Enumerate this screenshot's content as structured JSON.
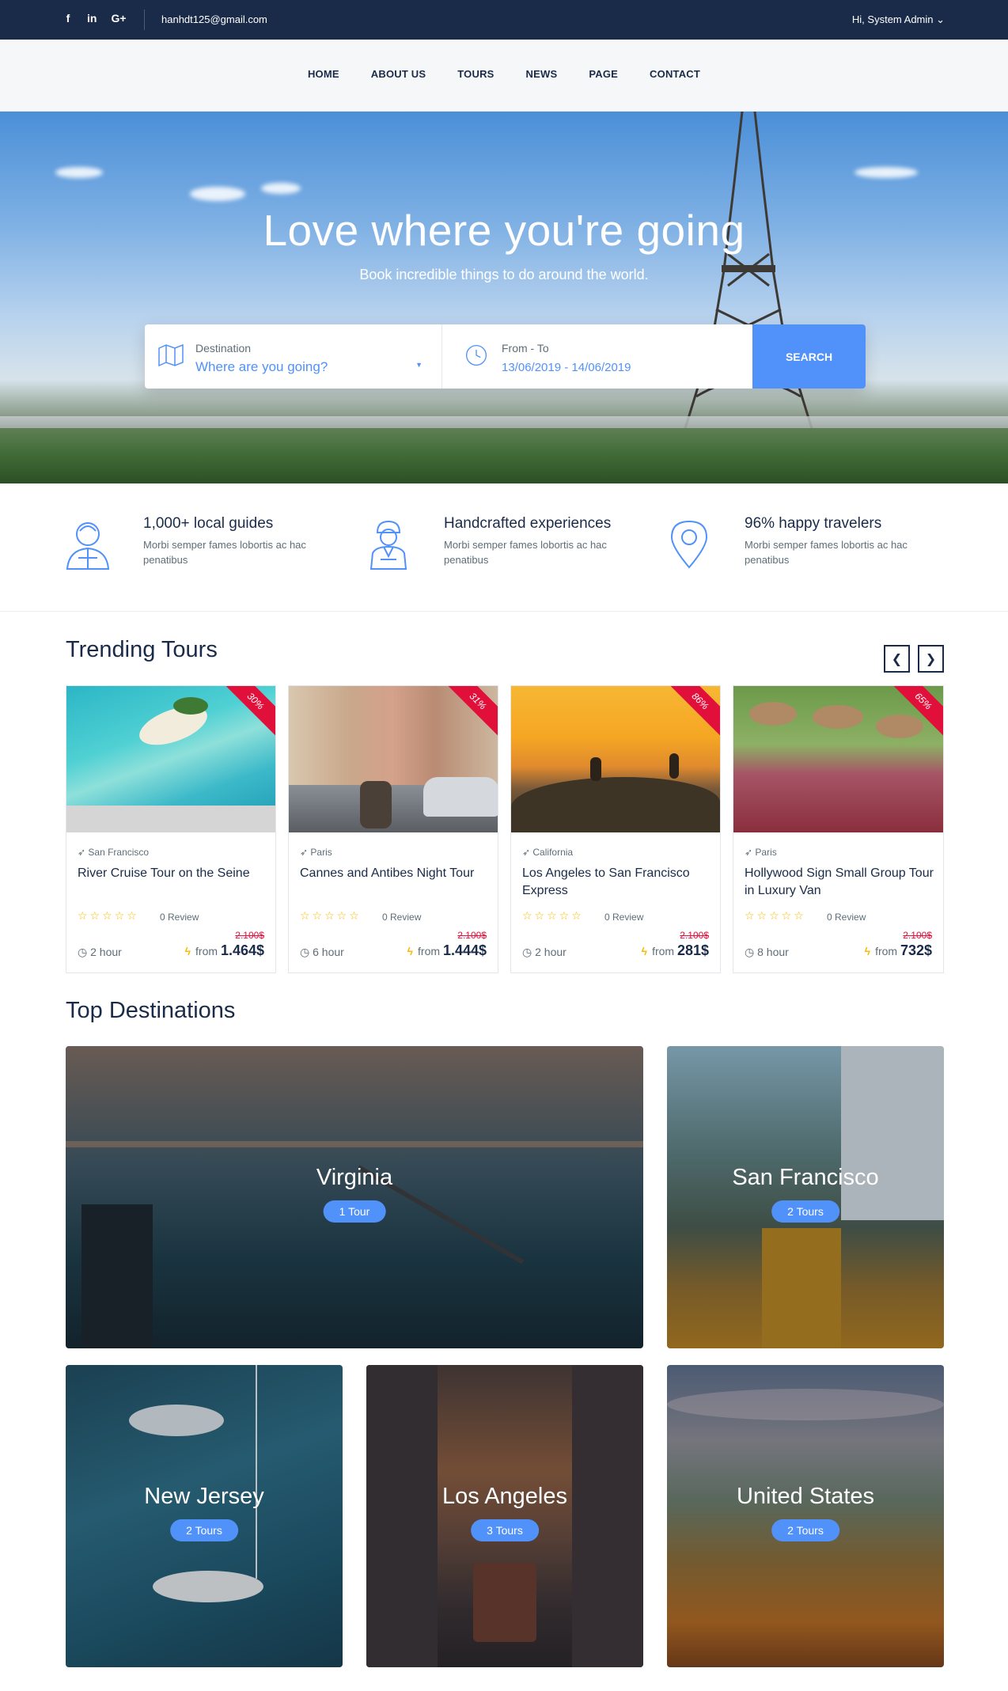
{
  "topbar": {
    "social": [
      "f",
      "in",
      "G+"
    ],
    "email": "hanhdt125@gmail.com",
    "account": "Hi, System Admin ⌄"
  },
  "nav": [
    "HOME",
    "ABOUT US",
    "TOURS",
    "NEWS",
    "PAGE",
    "CONTACT"
  ],
  "hero": {
    "title": "Love where you're going",
    "subtitle": "Book incredible things to do around the world."
  },
  "search": {
    "destination_label": "Destination",
    "destination_placeholder": "Where are you going?",
    "dates_label": "From - To",
    "dates_value": "13/06/2019 - 14/06/2019",
    "button": "SEARCH"
  },
  "features": [
    {
      "title": "1,000+ local guides",
      "desc": "Morbi semper fames lobortis ac hac penatibus"
    },
    {
      "title": "Handcrafted experiences",
      "desc": "Morbi semper fames lobortis ac hac penatibus"
    },
    {
      "title": "96% happy travelers",
      "desc": "Morbi semper fames lobortis ac hac penatibus"
    }
  ],
  "trending": {
    "title": "Trending Tours",
    "prev": "❮",
    "next": "❯",
    "tours": [
      {
        "discount": "30%",
        "location": "San Francisco",
        "name": "River Cruise Tour on the Seine",
        "stars": "☆☆☆☆☆",
        "reviews": "0 Review",
        "old_price": "2.100$",
        "duration": "2 hour",
        "from_label": "from",
        "price": "1.464$"
      },
      {
        "discount": "31%",
        "location": "Paris",
        "name": "Cannes and Antibes Night Tour",
        "stars": "☆☆☆☆☆",
        "reviews": "0 Review",
        "old_price": "2.100$",
        "duration": "6 hour",
        "from_label": "from",
        "price": "1.444$"
      },
      {
        "discount": "86%",
        "location": "California",
        "name": "Los Angeles to San Francisco Express",
        "stars": "☆☆☆☆☆",
        "reviews": "0 Review",
        "old_price": "2.100$",
        "duration": "2 hour",
        "from_label": "from",
        "price": "281$"
      },
      {
        "discount": "65%",
        "location": "Paris",
        "name": "Hollywood Sign Small Group Tour in Luxury Van",
        "stars": "☆☆☆☆☆",
        "reviews": "0 Review",
        "old_price": "2.100$",
        "duration": "8 hour",
        "from_label": "from",
        "price": "732$"
      }
    ]
  },
  "destinations": {
    "title": "Top Destinations",
    "items": [
      {
        "name": "Virginia",
        "count": "1 Tour"
      },
      {
        "name": "San Francisco",
        "count": "2 Tours"
      },
      {
        "name": "New Jersey",
        "count": "2 Tours"
      },
      {
        "name": "Los Angeles",
        "count": "3 Tours"
      },
      {
        "name": "United States",
        "count": "2 Tours"
      }
    ]
  },
  "colors": {
    "primary": "#5191fa",
    "dark": "#1a2b49",
    "sale": "#e1103b",
    "star": "#fabb00"
  }
}
